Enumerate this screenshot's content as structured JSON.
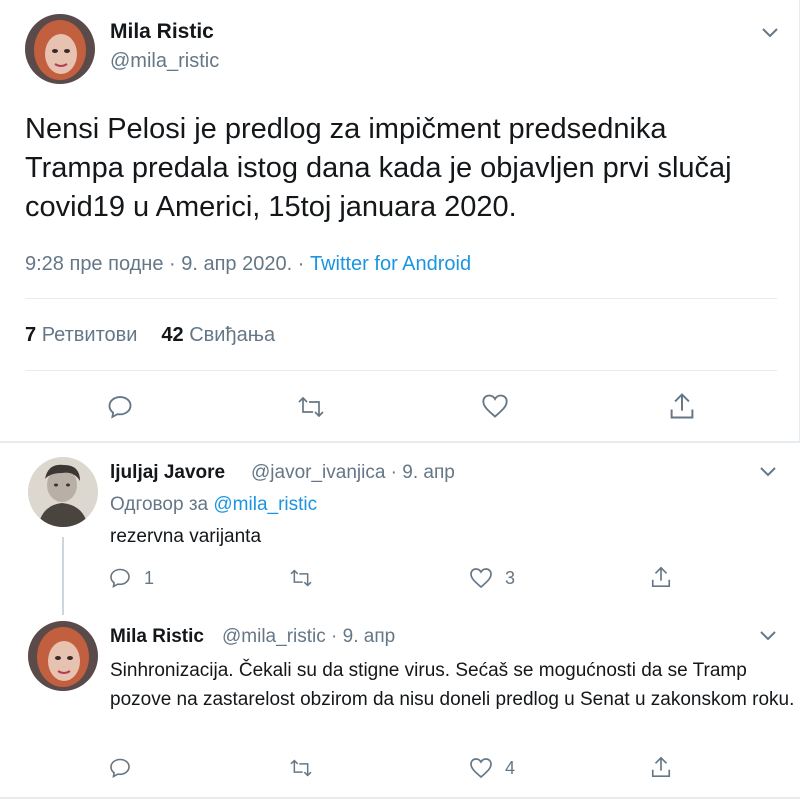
{
  "main_tweet": {
    "author_name": "Mila Ristic",
    "author_handle": "@mila_ristic",
    "text": "Nensi Pelosi je predlog za impičment predsednika Trampa predala istog dana kada je objavljen prvi slučaj covid19 u Americi, 15toj januara 2020.",
    "time": "9:28 пре подне · 9. апр 2020. · ",
    "source": "Twitter for Android",
    "retweets_count": "7",
    "retweets_label": "Ретвитови",
    "likes_count": "42",
    "likes_label": "Свиђања"
  },
  "replies": [
    {
      "author_name": "ljuljaj Javore",
      "author_handle": "@javor_ivanjica · 9. апр",
      "reply_to_label": "Одговор за ",
      "reply_to_handle": "@mila_ristic",
      "text": "rezervna varijanta",
      "reply_count": "1",
      "retweet_count": "",
      "like_count": "3"
    },
    {
      "author_name": "Mila Ristic",
      "author_handle": "@mila_ristic · 9. апр",
      "text": "Sinhronizacija. Čekali su da stigne virus. Sećaš se mogućnosti da se Tramp pozove na zastarelost obzirom da nisu doneli predlog u Senat u zakonskom roku.",
      "reply_count": "",
      "retweet_count": "",
      "like_count": "4"
    }
  ],
  "icons": {
    "reply": "reply-icon",
    "retweet": "retweet-icon",
    "like": "heart-icon",
    "share": "share-icon",
    "more": "chevron-down-icon"
  },
  "colors": {
    "text": "#14171a",
    "secondary": "#657786",
    "link": "#1b95e0",
    "divider": "#e6ecf0"
  }
}
